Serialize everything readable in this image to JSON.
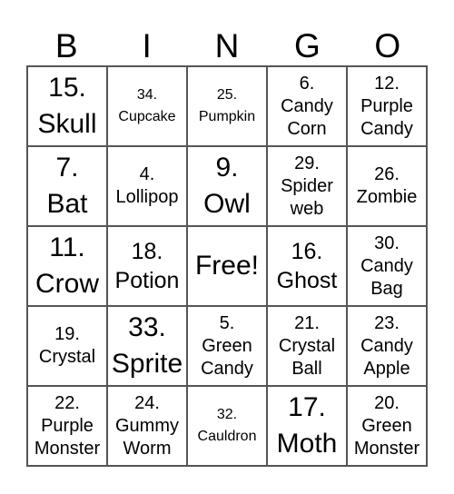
{
  "header": [
    "B",
    "I",
    "N",
    "G",
    "O"
  ],
  "cells": [
    {
      "lines": [
        "15.",
        "Skull"
      ],
      "size": 4
    },
    {
      "lines": [
        "34.",
        "Cupcake"
      ],
      "size": 1
    },
    {
      "lines": [
        "25.",
        "Pumpkin"
      ],
      "size": 1
    },
    {
      "lines": [
        "6.",
        "Candy",
        "Corn"
      ],
      "size": 2
    },
    {
      "lines": [
        "12.",
        "Purple",
        "Candy"
      ],
      "size": 2
    },
    {
      "lines": [
        "7.",
        "Bat"
      ],
      "size": 4
    },
    {
      "lines": [
        "4.",
        "Lollipop"
      ],
      "size": 2
    },
    {
      "lines": [
        "9.",
        "Owl"
      ],
      "size": 4
    },
    {
      "lines": [
        "29.",
        "Spider",
        "web"
      ],
      "size": 2
    },
    {
      "lines": [
        "26.",
        "Zombie"
      ],
      "size": 2
    },
    {
      "lines": [
        "11.",
        "Crow"
      ],
      "size": 4
    },
    {
      "lines": [
        "18.",
        "Potion"
      ],
      "size": 3
    },
    {
      "lines": [
        "Free!"
      ],
      "size": 4
    },
    {
      "lines": [
        "16.",
        "Ghost"
      ],
      "size": 3
    },
    {
      "lines": [
        "30.",
        "Candy",
        "Bag"
      ],
      "size": 2
    },
    {
      "lines": [
        "19.",
        "Crystal"
      ],
      "size": 2
    },
    {
      "lines": [
        "33.",
        "Sprite"
      ],
      "size": 4
    },
    {
      "lines": [
        "5.",
        "Green",
        "Candy"
      ],
      "size": 2
    },
    {
      "lines": [
        "21.",
        "Crystal",
        "Ball"
      ],
      "size": 2
    },
    {
      "lines": [
        "23.",
        "Candy",
        "Apple"
      ],
      "size": 2
    },
    {
      "lines": [
        "22.",
        "Purple",
        "Monster"
      ],
      "size": 2
    },
    {
      "lines": [
        "24.",
        "Gummy",
        "Worm"
      ],
      "size": 2
    },
    {
      "lines": [
        "32.",
        "Cauldron"
      ],
      "size": 1
    },
    {
      "lines": [
        "17.",
        "Moth"
      ],
      "size": 4
    },
    {
      "lines": [
        "20.",
        "Green",
        "Monster"
      ],
      "size": 2
    }
  ]
}
